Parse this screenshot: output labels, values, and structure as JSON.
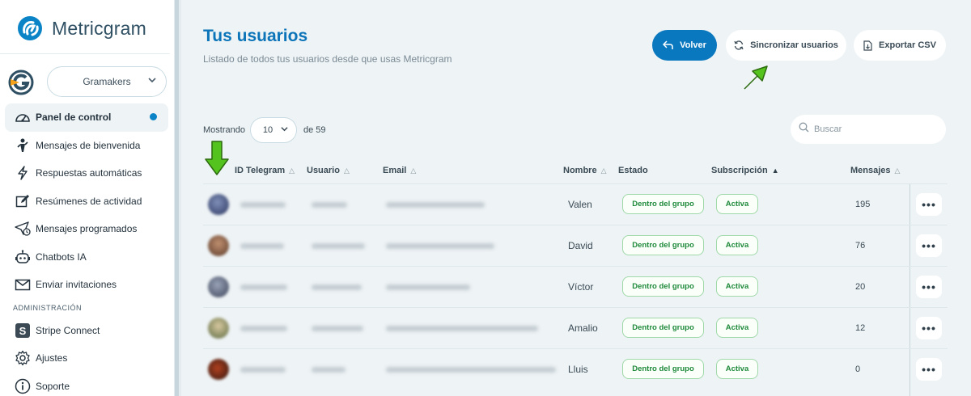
{
  "sidebar": {
    "brand": "Metricgram",
    "account": "Gramakers",
    "items": [
      {
        "label": "Panel de control",
        "icon": "gauge-icon"
      },
      {
        "label": "Mensajes de bienvenida",
        "icon": "person-icon"
      },
      {
        "label": "Respuestas automáticas",
        "icon": "bolt-icon"
      },
      {
        "label": "Resúmenes de actividad",
        "icon": "edit-icon"
      },
      {
        "label": "Mensajes programados",
        "icon": "send-clock-icon"
      },
      {
        "label": "Chatbots IA",
        "icon": "robot-icon"
      },
      {
        "label": "Enviar invitaciones",
        "icon": "mail-icon"
      }
    ],
    "section_admin": "ADMINISTRACIÓN",
    "admin_items": [
      {
        "label": "Stripe Connect",
        "icon": "stripe-icon"
      },
      {
        "label": "Ajustes",
        "icon": "gear-icon"
      },
      {
        "label": "Soporte",
        "icon": "info-icon"
      }
    ]
  },
  "main": {
    "title": "Tus usuarios",
    "subtitle": "Listado de todos tus usuarios desde que usas Metricgram",
    "buttons": {
      "back": "Volver",
      "sync": "Sincronizar usuarios",
      "export": "Exportar CSV"
    },
    "showing_label": "Mostrando",
    "per_page": "10",
    "total_label": "de 59",
    "search_placeholder": "Buscar",
    "columns": {
      "id": "ID Telegram",
      "user": "Usuario",
      "email": "Email",
      "name": "Nombre",
      "status": "Estado",
      "subscription": "Subscripción",
      "messages": "Mensajes"
    },
    "rows": [
      {
        "name": "Valen",
        "status": "Dentro del grupo",
        "subscription": "Activa",
        "messages": "195"
      },
      {
        "name": "David",
        "status": "Dentro del grupo",
        "subscription": "Activa",
        "messages": "76"
      },
      {
        "name": "Víctor",
        "status": "Dentro del grupo",
        "subscription": "Activa",
        "messages": "20"
      },
      {
        "name": "Amalio",
        "status": "Dentro del grupo",
        "subscription": "Activa",
        "messages": "12"
      },
      {
        "name": "Lluis",
        "status": "Dentro del grupo",
        "subscription": "Activa",
        "messages": "0"
      }
    ]
  },
  "colors": {
    "accent": "#0a78bf",
    "title": "#0c74b8",
    "success": "#1f8a3b",
    "arrow": "#55c31e"
  }
}
